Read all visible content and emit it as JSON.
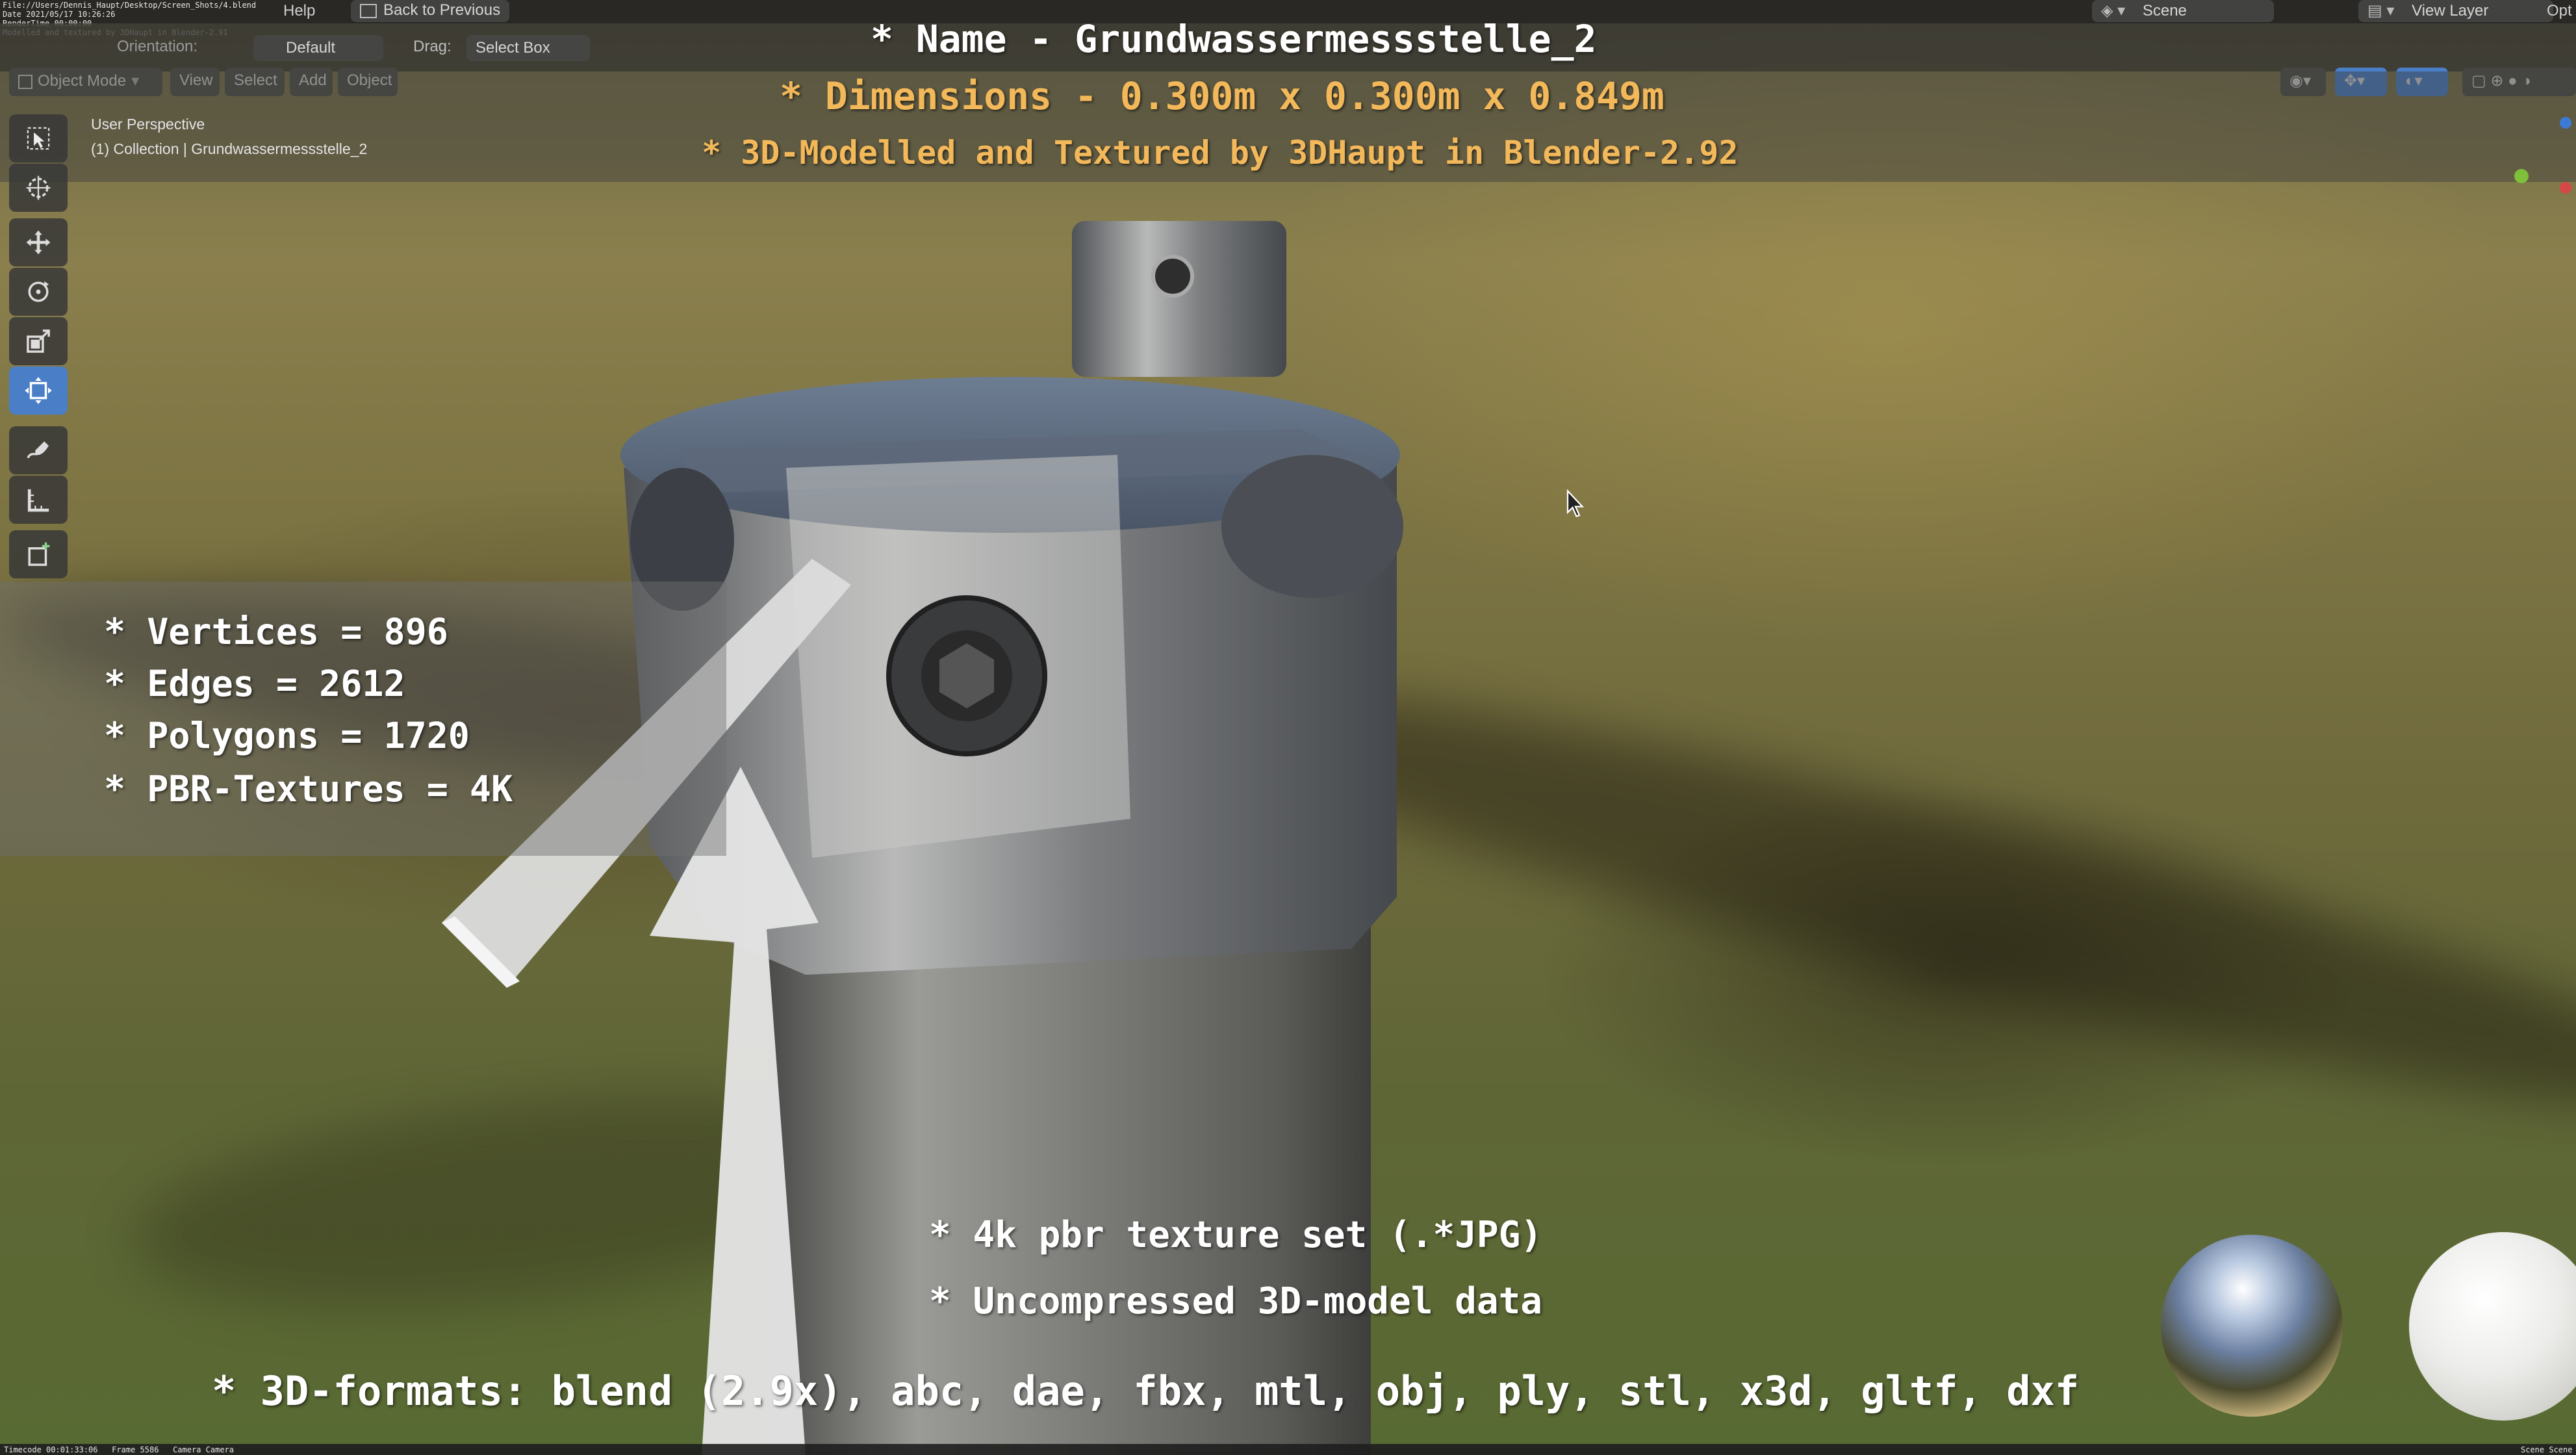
{
  "top_bar": {
    "file_info": "File://Users/Dennis_Haupt/Desktop/Screen_Shots/4.blend\nDate 2021/05/17 10:26:26\nRenderTime 00:00:00\nModelled and textured by 3DHaupt in Blender-2.91",
    "menu_help": "Help",
    "back_to_previous": "Back to Previous",
    "scene_label": "Scene",
    "view_layer_label": "View Layer",
    "opt_label": "Opt"
  },
  "header": {
    "orientation_label": "Orientation:",
    "orientation_value": "Default",
    "drag_label": "Drag:",
    "drag_value": "Select Box",
    "mode_value": "Object Mode",
    "view_menu": "View",
    "select_menu": "Select",
    "add_menu": "Add",
    "object_menu": "Object"
  },
  "viewport_info": {
    "perspective": "User Perspective",
    "collection": "(1) Collection | Grundwassermessstelle_2"
  },
  "overlay": {
    "name_line": "* Name - Grundwassermessstelle_2",
    "dimensions_line": "* Dimensions -  0.300m x 0.300m x 0.849m",
    "credit_line": "* 3D-Modelled and Textured by 3DHaupt in Blender-2.92",
    "stats": [
      "* Vertices = 896",
      "* Edges = 2612",
      "* Polygons = 1720",
      "* PBR-Textures = 4K"
    ],
    "texture_line": "* 4k pbr texture set (.*JPG)",
    "data_line": "* Uncompressed 3D-model data",
    "formats_line": "* 3D-formats: blend (2.9x), abc, dae, fbx, mtl, obj, ply, stl, x3d, gltf, dxf"
  },
  "status_bar": {
    "timecode": "Timecode 00:01:33:06   Frame 5586   Camera Camera",
    "scene_right": "Scene Scene"
  },
  "colors": {
    "title_white": "#ffffff",
    "accent_orange": "#f2b85a",
    "tool_active": "#4a7fc8"
  },
  "icons": [
    "select-box-icon",
    "cursor-icon",
    "move-icon",
    "rotate-icon",
    "scale-icon",
    "transform-icon",
    "annotate-icon",
    "measure-icon",
    "add-cube-icon"
  ]
}
